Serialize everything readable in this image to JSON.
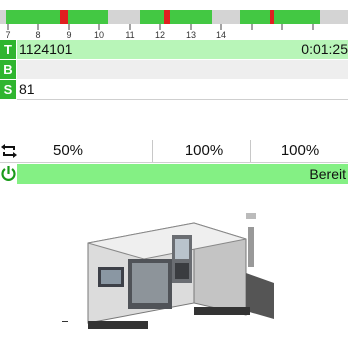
{
  "timeline": {
    "ticks": [
      "7",
      "8",
      "9",
      "10",
      "11",
      "12",
      "13",
      "14"
    ]
  },
  "tool": {
    "tag": "T",
    "value": "1124101",
    "time": "0:01:25"
  },
  "bs": {
    "tag": "B",
    "value": ""
  },
  "spindle": {
    "tag": "S",
    "value": "81"
  },
  "overrides": {
    "icon": "cycle-icon",
    "values": [
      "50%",
      "100%",
      "100%"
    ]
  },
  "status": {
    "icon": "power-icon",
    "text": "Bereit"
  },
  "colors": {
    "green": "#2fb52f",
    "light_green": "#b8f5b8",
    "status_green": "#84f084",
    "alarm_red": "#e02020"
  }
}
